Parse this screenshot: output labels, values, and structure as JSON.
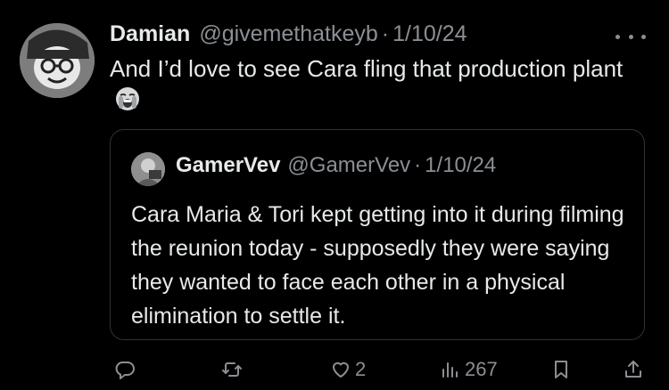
{
  "tweet": {
    "author_name": "Damian",
    "handle": "@givemethatkeyb",
    "separator": "·",
    "date": "1/10/24",
    "text": "And I’d love to see Cara fling that production plant",
    "emoji_icon": "loudly-crying-face-icon",
    "more_icon": "more-dots-icon"
  },
  "quote": {
    "author_name": "GamerVev",
    "handle": "@GamerVev",
    "separator": "·",
    "date": "1/10/24",
    "text": "Cara Maria & Tori kept getting into it during filming the reunion today - supposedly they were saying they wanted to face each other in a physical elimination to settle it."
  },
  "actions": {
    "reply_icon": "reply-icon",
    "retweet_icon": "retweet-icon",
    "like_icon": "heart-icon",
    "like_count": "2",
    "views_icon": "views-chart-icon",
    "views_count": "267",
    "bookmark_icon": "bookmark-icon",
    "share_icon": "share-icon"
  },
  "colors": {
    "background": "#000000",
    "text": "#e7e9ea",
    "muted": "#8b8f94",
    "border": "#2f3336"
  }
}
